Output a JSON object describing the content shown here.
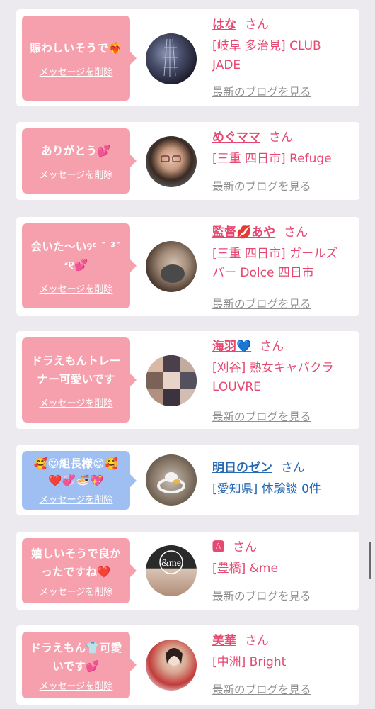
{
  "messages": [
    {
      "message_lines": [
        "賑わしいそうで❤️‍🔥"
      ],
      "delete_label": "メッセージを削除",
      "name": "はな",
      "honorific": "さん",
      "shop_lines": [
        "[岐阜 多治見] CLUB",
        "JADE"
      ],
      "blog_label": "最新のブログを見る",
      "theme": "pink"
    },
    {
      "message_lines": [
        "ありがとう💕"
      ],
      "delete_label": "メッセージを削除",
      "name": "めぐママ",
      "honorific": "さん",
      "shop_lines": [
        "[三重 四日市] Refuge"
      ],
      "blog_label": "最新のブログを見る",
      "theme": "pink"
    },
    {
      "message_lines": [
        "会いた〜い୨ᵋ ˘ ³˘",
        "ᵌ୧💕"
      ],
      "delete_label": "メッセージを削除",
      "name": "監督💋あや",
      "honorific": "さん",
      "shop_lines": [
        "[三重 四日市] ガールズ",
        "バー Dolce 四日市"
      ],
      "blog_label": "最新のブログを見る",
      "theme": "pink"
    },
    {
      "message_lines": [
        "ドラえもんトレー",
        "ナー可愛いです"
      ],
      "delete_label": "メッセージを削除",
      "name": "海羽💙",
      "honorific": "さん",
      "shop_lines": [
        "[刈谷] 熟女キャバクラ",
        "LOUVRE"
      ],
      "blog_label": "最新のブログを見る",
      "theme": "pink"
    },
    {
      "message_lines": [
        "🥰😍組長様😍🥰",
        "❤️💞🍜💖"
      ],
      "delete_label": "メッセージを削除",
      "name": "明日のゼン",
      "honorific": "さん",
      "shop_lines": [
        "[愛知県] 体験談 0件"
      ],
      "blog_label": "",
      "theme": "blue"
    },
    {
      "message_lines": [
        "嬉しいそうで良か",
        "ったですね❤️"
      ],
      "delete_label": "メッセージを削除",
      "name": "🅰",
      "honorific": "さん",
      "shop_lines": [
        "[豊橋] &me"
      ],
      "blog_label": "最新のブログを見る",
      "theme": "pink"
    },
    {
      "message_lines": [
        "ドラえもん👕可愛",
        "いです💕"
      ],
      "delete_label": "メッセージを削除",
      "name": "美華",
      "honorific": "さん",
      "shop_lines": [
        "[中洲] Bright"
      ],
      "blog_label": "最新のブログを見る",
      "theme": "pink"
    }
  ],
  "avatar_texts": {
    "me_logo": "&me"
  },
  "colors": {
    "pink_bubble": "#f6a0ad",
    "blue_bubble": "#9fbff3",
    "pink_text": "#e64872",
    "blue_text": "#2569b2",
    "muted_link": "#8f8f8f",
    "page_background": "#eceaee"
  }
}
